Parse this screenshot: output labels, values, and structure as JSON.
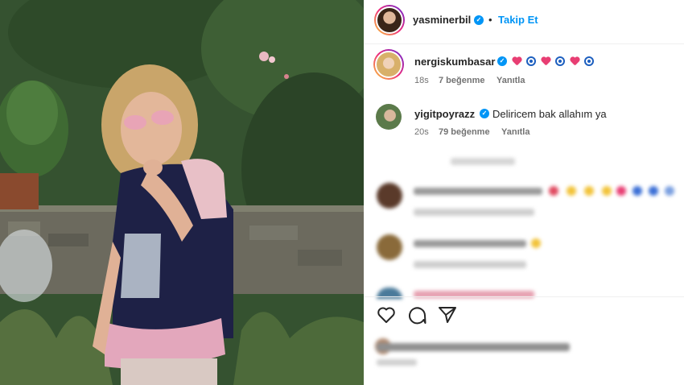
{
  "post": {
    "author": "yasminerbil",
    "follow_dot": "•",
    "follow_label": "Takip Et"
  },
  "comments": [
    {
      "username": "nergiskumbasar",
      "time": "18s",
      "likes": "7 beğenme",
      "reply": "Yanıtla",
      "emojis": [
        "heart",
        "nazar",
        "heart",
        "nazar",
        "heart",
        "nazar"
      ]
    },
    {
      "username": "yigitpoyrazz",
      "text": "Deliricem bak allahım ya",
      "time": "20s",
      "likes": "79 beğenme",
      "reply": "Yanıtla"
    }
  ],
  "icons": {
    "verified": "verified-badge",
    "like": "heart-outline-icon",
    "comment": "comment-bubble-icon",
    "share": "paper-plane-icon"
  },
  "colors": {
    "accent": "#0095f6",
    "heart_emoji": "#e83e73",
    "nazar": "#1d5fbf"
  }
}
